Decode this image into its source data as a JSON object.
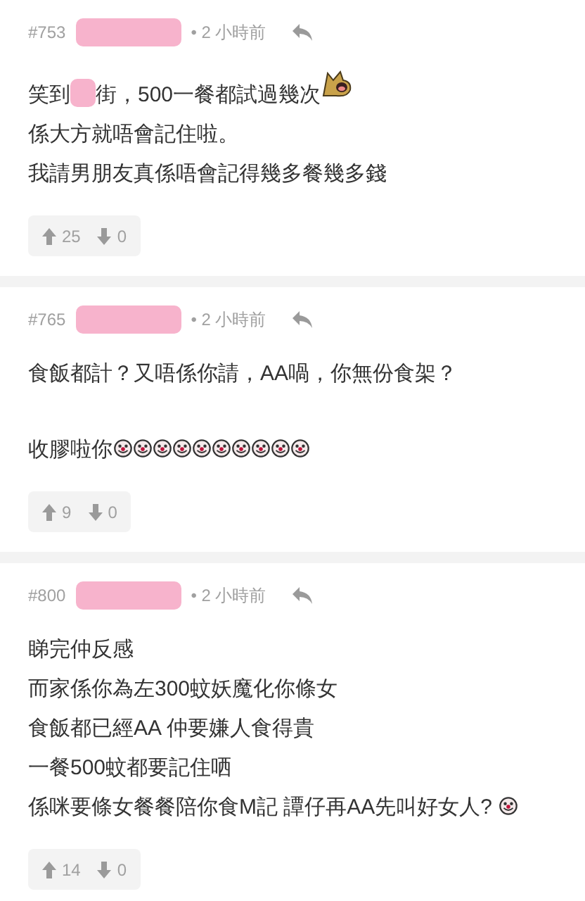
{
  "posts": [
    {
      "number": "#753",
      "time": "• 2 小時前",
      "paragraphs": [
        [
          [
            {
              "kind": "text",
              "text": "笑到"
            },
            {
              "kind": "redaction"
            },
            {
              "kind": "text",
              "text": "街，500一餐都試過幾次"
            },
            {
              "kind": "sticker"
            }
          ],
          [
            {
              "kind": "text",
              "text": "係大方就唔會記住啦。"
            }
          ],
          [
            {
              "kind": "text",
              "text": "我請男朋友真係唔會記得幾多餐幾多錢"
            }
          ]
        ]
      ],
      "up": "25",
      "down": "0"
    },
    {
      "number": "#765",
      "time": "• 2 小時前",
      "paragraphs": [
        [
          [
            {
              "kind": "text",
              "text": "食飯都計？又唔係你請，AA喎，你無份食架？"
            }
          ]
        ],
        [
          [
            {
              "kind": "text",
              "text": "收膠啦你"
            },
            {
              "kind": "smiley"
            },
            {
              "kind": "smiley"
            },
            {
              "kind": "smiley"
            },
            {
              "kind": "smiley"
            },
            {
              "kind": "smiley"
            },
            {
              "kind": "smiley"
            },
            {
              "kind": "smiley"
            },
            {
              "kind": "smiley"
            },
            {
              "kind": "smiley"
            },
            {
              "kind": "smiley"
            }
          ]
        ]
      ],
      "up": "9",
      "down": "0"
    },
    {
      "number": "#800",
      "time": "• 2 小時前",
      "paragraphs": [
        [
          [
            {
              "kind": "text",
              "text": "睇完仲反感"
            }
          ],
          [
            {
              "kind": "text",
              "text": "而家係你為左300蚊妖魔化你條女"
            }
          ],
          [
            {
              "kind": "text",
              "text": "食飯都已經AA 仲要嫌人食得貴"
            }
          ],
          [
            {
              "kind": "text",
              "text": "一餐500蚊都要記住哂"
            }
          ],
          [
            {
              "kind": "text",
              "text": "係咪要條女餐餐陪你食M記 譚仔再AA先叫好女人? "
            },
            {
              "kind": "smiley"
            }
          ]
        ]
      ],
      "up": "14",
      "down": "0"
    }
  ]
}
